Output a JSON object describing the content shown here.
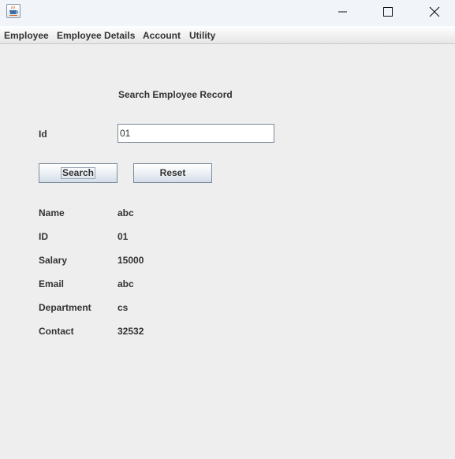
{
  "window": {
    "title": "",
    "icon": "java-cup-icon"
  },
  "menubar": {
    "items": [
      "Employee",
      "Employee Details",
      "Account",
      "Utility"
    ]
  },
  "form": {
    "heading": "Search Employee Record",
    "id_label": "Id",
    "id_value": "01",
    "search_label": "Search",
    "reset_label": "Reset"
  },
  "record": {
    "fields": [
      {
        "label": "Name",
        "value": "abc"
      },
      {
        "label": "ID",
        "value": "01"
      },
      {
        "label": "Salary",
        "value": "15000"
      },
      {
        "label": "Email",
        "value": "abc"
      },
      {
        "label": "Department",
        "value": "cs"
      },
      {
        "label": "Contact",
        "value": "32532"
      }
    ]
  },
  "colors": {
    "window_bg": "#eeeeee",
    "titlebar_bg": "#f1f4f9",
    "button_border": "#7a8a99",
    "text": "#333333"
  }
}
